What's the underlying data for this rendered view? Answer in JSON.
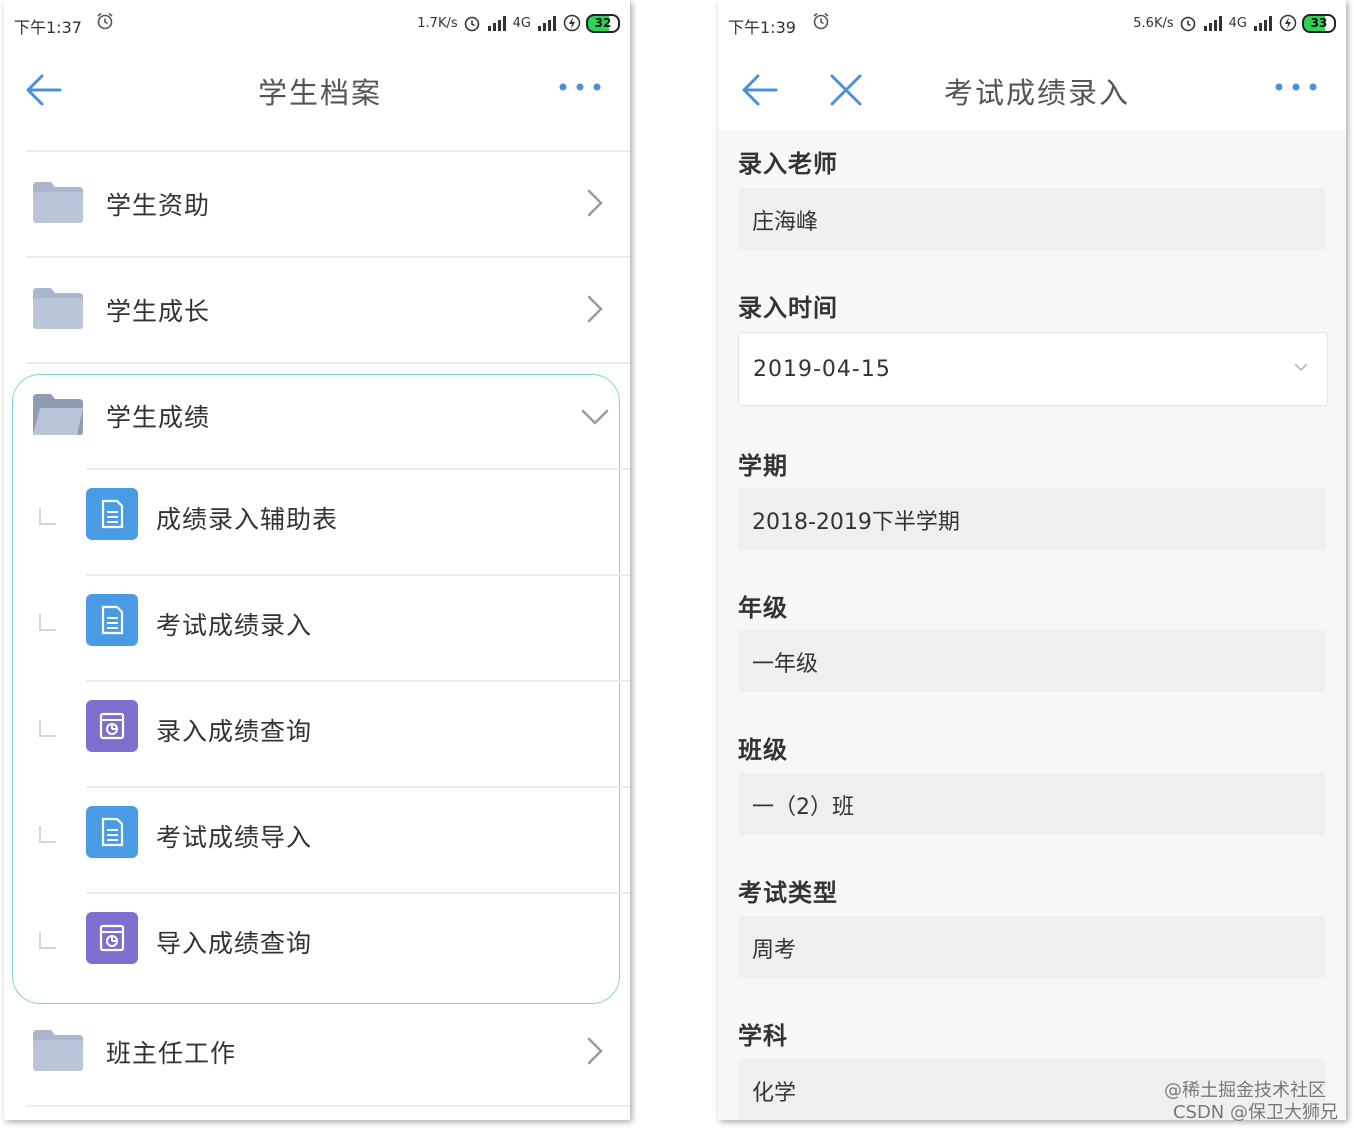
{
  "left_screen": {
    "status": {
      "time": "下午1:37",
      "speed": "1.7K/s",
      "network": "4G",
      "battery": "32"
    },
    "title": "学生档案",
    "items": [
      {
        "label": "学生资助"
      },
      {
        "label": "学生成长"
      },
      {
        "label": "学生成绩"
      },
      {
        "label": "班主任工作"
      }
    ],
    "sub_items": [
      {
        "label": "成绩录入辅助表",
        "icon": "document-icon",
        "color": "#4a9be6"
      },
      {
        "label": "考试成绩录入",
        "icon": "document-icon",
        "color": "#4a9be6"
      },
      {
        "label": "录入成绩查询",
        "icon": "report-icon",
        "color": "#7c6fce"
      },
      {
        "label": "考试成绩导入",
        "icon": "document-icon",
        "color": "#4a9be6"
      },
      {
        "label": "导入成绩查询",
        "icon": "report-icon",
        "color": "#7c6fce"
      }
    ]
  },
  "right_screen": {
    "status": {
      "time": "下午1:39",
      "speed": "5.6K/s",
      "network": "4G",
      "battery": "33"
    },
    "title": "考试成绩录入",
    "fields": [
      {
        "label": "录入老师",
        "value": "庄海峰"
      },
      {
        "label": "录入时间",
        "value": "2019-04-15"
      },
      {
        "label": "学期",
        "value": "2018-2019下半学期"
      },
      {
        "label": "年级",
        "value": "一年级"
      },
      {
        "label": "班级",
        "value": "一（2）班"
      },
      {
        "label": "考试类型",
        "value": "周考"
      },
      {
        "label": "学科",
        "value": "化学"
      }
    ]
  },
  "watermark": {
    "line1": "@稀土掘金技术社区",
    "line2": "CSDN @保卫大狮兄"
  },
  "colors": {
    "accent": "#4a8fe0",
    "folder": "#a9b6cb",
    "group_border": "#7ad6cf"
  }
}
